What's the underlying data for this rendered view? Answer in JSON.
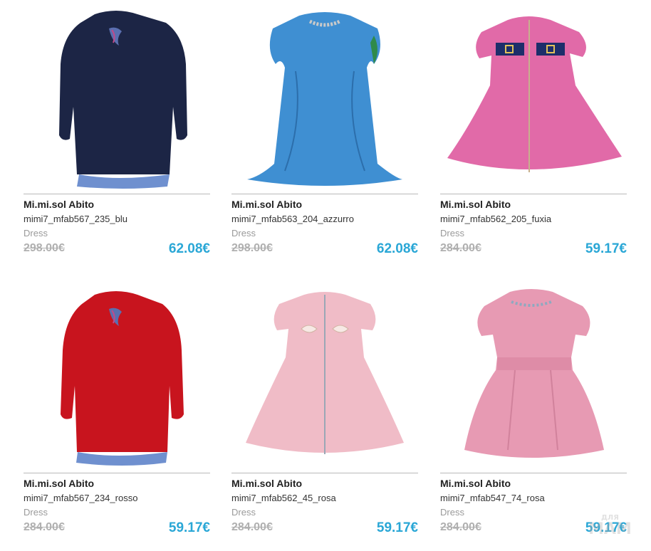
{
  "colors": {
    "price": "#2aa7d6",
    "old_price": "#b0b0b0",
    "category": "#9a9a9a",
    "separator": "#b9b9b9"
  },
  "products": [
    {
      "image_icon": "navy-sweater-dress-image",
      "brand": "Mi.mi.sol Abito",
      "sku": "mimi7_mfab567_235_blu",
      "category": "Dress",
      "old_price": "298.00€",
      "price": "62.08€"
    },
    {
      "image_icon": "blue-satin-dress-image",
      "brand": "Mi.mi.sol Abito",
      "sku": "mimi7_mfab563_204_azzurro",
      "category": "Dress",
      "old_price": "298.00€",
      "price": "62.08€"
    },
    {
      "image_icon": "pink-zip-dress-image",
      "brand": "Mi.mi.sol Abito",
      "sku": "mimi7_mfab562_205_fuxia",
      "category": "Dress",
      "old_price": "284.00€",
      "price": "59.17€"
    },
    {
      "image_icon": "red-sweater-dress-image",
      "brand": "Mi.mi.sol Abito",
      "sku": "mimi7_mfab567_234_rosso",
      "category": "Dress",
      "old_price": "284.00€",
      "price": "59.17€"
    },
    {
      "image_icon": "pink-brocade-dress-image",
      "brand": "Mi.mi.sol Abito",
      "sku": "mimi7_mfab562_45_rosa",
      "category": "Dress",
      "old_price": "284.00€",
      "price": "59.17€"
    },
    {
      "image_icon": "pink-pleated-dress-image",
      "brand": "Mi.mi.sol Abito",
      "sku": "mimi7_mfab547_74_rosa",
      "category": "Dress",
      "old_price": "284.00€",
      "price": "59.17€"
    }
  ],
  "watermark": {
    "line1": "ДЛЯ",
    "line2": "МАМ"
  }
}
